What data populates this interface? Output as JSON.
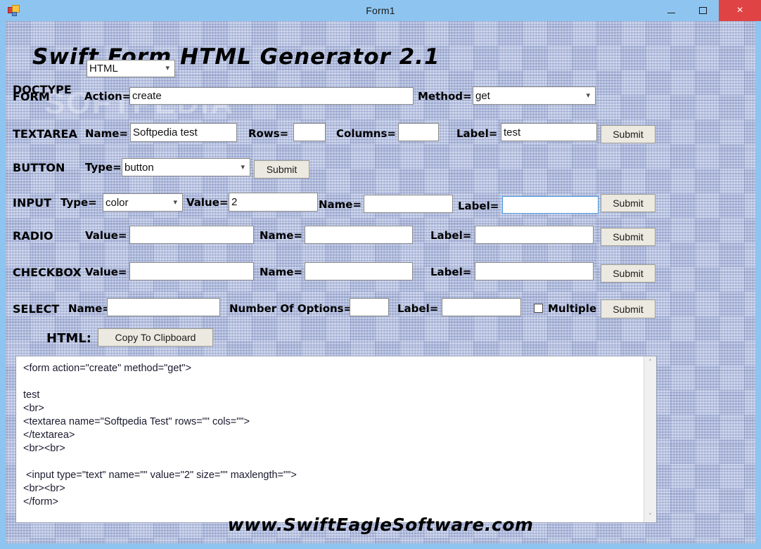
{
  "window": {
    "title": "Form1",
    "icon": "winforms-icon",
    "minimize_label": "–",
    "maximize_label": "□",
    "close_label": "×"
  },
  "app": {
    "title": "Swift Form HTML Generator 2.1",
    "watermark": "SOFTPEDIA",
    "footer": "www.SwiftEagleSoftware.com",
    "colors": {
      "titlebar": "#8ec5f0",
      "close_button": "#e04343",
      "background": "#a9b6dc",
      "focus_border": "#4a9ce0",
      "button_face": "#ece9e0"
    }
  },
  "rows": {
    "doctype": {
      "section_label": "DOCTYPE",
      "select_value": "HTML"
    },
    "form": {
      "section_label": "FORM",
      "action_label": "Action=",
      "action_value": "create",
      "method_label": "Method=",
      "method_value": "get"
    },
    "textarea": {
      "section_label": "TEXTAREA",
      "name_label": "Name=",
      "name_value": "Softpedia test",
      "rows_label": "Rows=",
      "rows_value": "",
      "columns_label": "Columns=",
      "columns_value": "",
      "label_label": "Label=",
      "label_value": "test",
      "submit_label": "Submit"
    },
    "button": {
      "section_label": "BUTTON",
      "type_label": "Type=",
      "type_value": "button",
      "submit_label": "Submit"
    },
    "input": {
      "section_label": "INPUT",
      "type_label": "Type=",
      "type_value": "color",
      "value_label": "Value=",
      "value_value": "2",
      "name_label": "Name=",
      "name_value": "",
      "label_label": "Label=",
      "label_value": "",
      "submit_label": "Submit"
    },
    "radio": {
      "section_label": "RADIO",
      "value_label": "Value=",
      "value_value": "",
      "name_label": "Name=",
      "name_value": "",
      "label_label": "Label=",
      "label_value": "",
      "submit_label": "Submit"
    },
    "checkbox": {
      "section_label": "CHECKBOX",
      "value_label": "Value=",
      "value_value": "",
      "name_label": "Name=",
      "name_value": "",
      "label_label": "Label=",
      "label_value": "",
      "submit_label": "Submit"
    },
    "select": {
      "section_label": "SELECT",
      "name_label": "Name=",
      "name_value": "",
      "options_label": "Number Of Options=",
      "options_value": "",
      "label_label": "Label=",
      "label_value": "",
      "multiple_label": "Multiple",
      "multiple_checked": false,
      "submit_label": "Submit"
    },
    "html": {
      "section_label": "HTML:",
      "copy_label": "Copy To Clipboard"
    }
  },
  "output": {
    "text": "<form action=\"create\" method=\"get\">\n\ntest\n<br>\n<textarea name=\"Softpedia Test\" rows=\"\" cols=\"\">\n</textarea>\n<br><br>\n\n <input type=\"text\" name=\"\" value=\"2\" size=\"\" maxlength=\"\">\n<br><br>\n</form>",
    "scroll_up_icon": "˄",
    "scroll_down_icon": "˅"
  }
}
